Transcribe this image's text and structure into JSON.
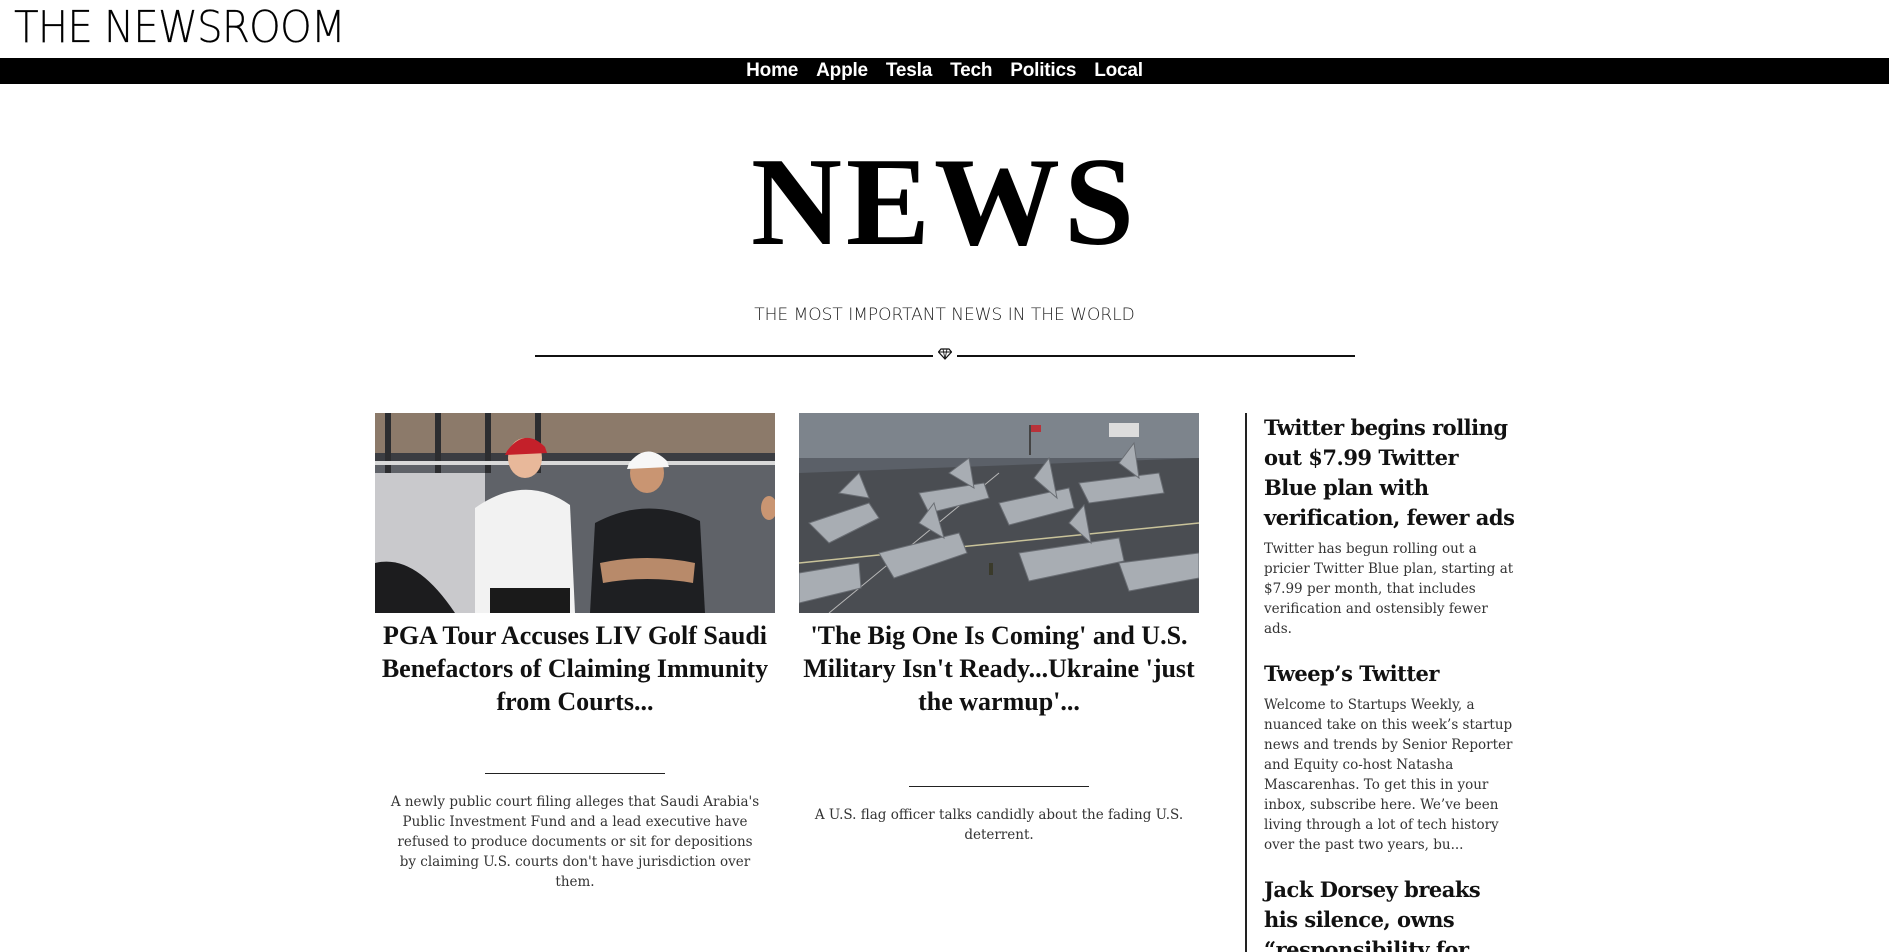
{
  "site": {
    "logo": "THE NEWSROOM"
  },
  "nav": {
    "items": [
      "Home",
      "Apple",
      "Tesla",
      "Tech",
      "Politics",
      "Local"
    ]
  },
  "hero": {
    "title": "NEWS",
    "tagline": "THE MOST IMPORTANT NEWS IN THE WORLD",
    "divider_icon": "diamond-icon"
  },
  "featured": [
    {
      "title": "PGA Tour Accuses LIV Golf Saudi Benefactors of Claiming Immunity from Courts...",
      "description": "A newly public court filing alleges that Saudi Arabia's Public Investment Fund and a lead executive have refused to produce documents or sit for depositions by claiming U.S. courts don't have jurisdiction over them."
    },
    {
      "title": "'The Big One Is Coming' and U.S. Military Isn't Ready...Ukraine 'just the warmup'...",
      "description": "A U.S. flag officer talks candidly about the fading U.S. deterrent."
    }
  ],
  "sidebar": [
    {
      "title": "Twitter begins rolling out $7.99 Twitter Blue plan with verification, fewer ads",
      "description": "Twitter has begun rolling out a pricier Twitter Blue plan, starting at $7.99 per month, that includes verification and ostensibly fewer ads."
    },
    {
      "title": "Tweep’s Twitter",
      "description": "Welcome to Startups Weekly, a nuanced take on this week’s startup news and trends by Senior Reporter and Equity co-host Natasha Mascarenhas. To get this in your inbox, subscribe here. We’ve been living through a lot of tech history over the past two years, bu..."
    },
    {
      "title": "Jack Dorsey breaks his silence, owns “responsibility for why",
      "description": ""
    }
  ]
}
